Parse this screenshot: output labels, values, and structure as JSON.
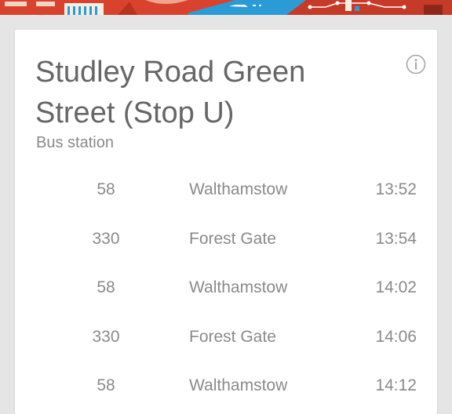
{
  "stop": {
    "name": "Studley Road Green Street (Stop U)",
    "type": "Bus station"
  },
  "icons": {
    "info": "info-icon"
  },
  "departures": [
    {
      "route": "58",
      "destination": "Walthamstow",
      "time": "13:52"
    },
    {
      "route": "330",
      "destination": "Forest Gate",
      "time": "13:54"
    },
    {
      "route": "58",
      "destination": "Walthamstow",
      "time": "14:02"
    },
    {
      "route": "330",
      "destination": "Forest Gate",
      "time": "14:06"
    },
    {
      "route": "58",
      "destination": "Walthamstow",
      "time": "14:12"
    }
  ],
  "colors": {
    "background": "#e5e5e5",
    "card": "#ffffff",
    "title_text": "#666666",
    "secondary_text": "#8a8a8a",
    "banner_red": "#d9432e",
    "banner_blue": "#2a9bd5"
  }
}
